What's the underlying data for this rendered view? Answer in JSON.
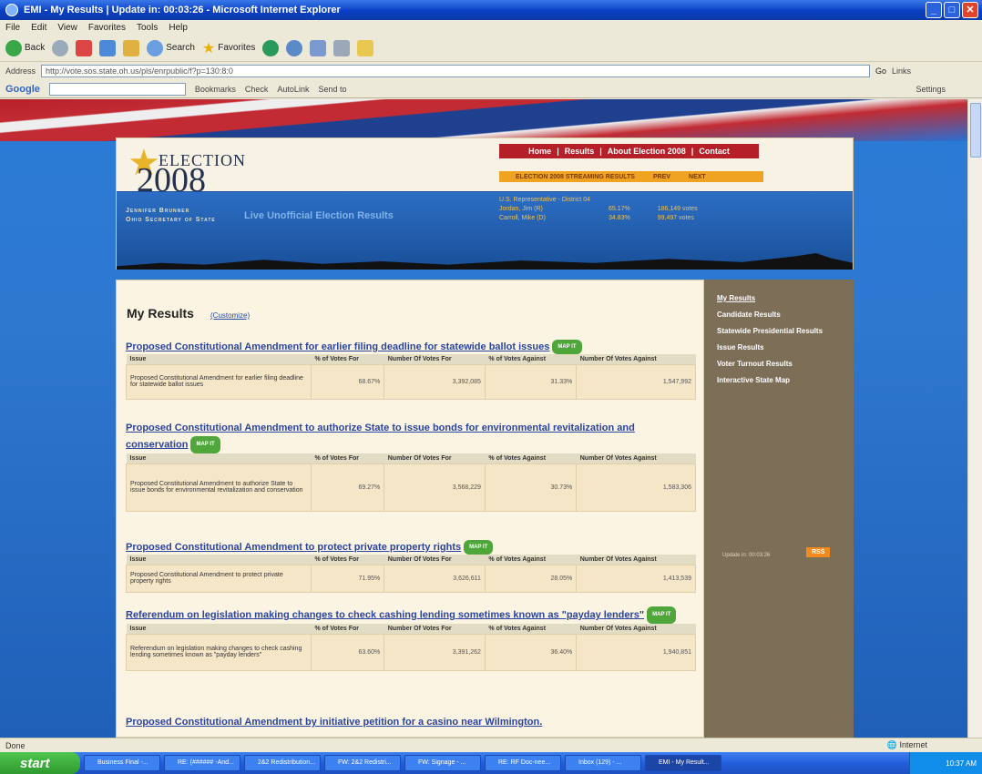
{
  "window": {
    "title": "EMI - My Results | Update in: 00:03:26 - Microsoft Internet Explorer"
  },
  "menu": [
    "File",
    "Edit",
    "View",
    "Favorites",
    "Tools",
    "Help"
  ],
  "toolbar": {
    "back": "Back",
    "search": "Search",
    "favorites": "Favorites"
  },
  "address": {
    "label": "Address",
    "url": "http://vote.sos.state.oh.us/pls/enrpublic/f?p=130:8:0",
    "go": "Go",
    "links": "Links"
  },
  "googlebar": {
    "brand": "Google",
    "bookmarks": "Bookmarks",
    "check": "Check",
    "autolink": "AutoLink",
    "sendto": "Send to",
    "settings": "Settings"
  },
  "site": {
    "logo_election": "ELECTION",
    "logo_year": "2008",
    "nav": [
      "Home",
      "Results",
      "About Election 2008",
      "Contact"
    ],
    "ticker": {
      "label": "ELECTION 2008 STREAMING RESULTS",
      "prev": "PREV",
      "next": "NEXT"
    },
    "sos_name": "Jennifer Brunner",
    "sos_title": "Ohio Secretary of State",
    "tagline": "Live Unofficial Election Results",
    "ticker_race": "U.S. Representative - District 04",
    "ticker_rows": [
      {
        "name": "Jordan, Jim (R)",
        "pct": "65.17%",
        "votes": "186,149 votes"
      },
      {
        "name": "Carroll, Mike (D)",
        "pct": "34.83%",
        "votes": "99,497 votes"
      }
    ]
  },
  "main": {
    "heading": "My Results",
    "customize": "(Customize)",
    "map_label": "MAP IT",
    "headers": [
      "Issue",
      "% of Votes For",
      "Number Of Votes For",
      "% of Votes Against",
      "Number Of Votes Against"
    ],
    "issues": [
      {
        "title": "Proposed Constitutional Amendment for earlier filing deadline for statewide ballot issues",
        "issue": "Proposed Constitutional Amendment for earlier filing deadline for statewide ballot issues",
        "pct_for": "68.67%",
        "num_for": "3,392,085",
        "pct_against": "31.33%",
        "num_against": "1,547,992"
      },
      {
        "title": "Proposed Constitutional Amendment to authorize State to issue bonds for environmental revitalization and conservation",
        "issue": "Proposed Constitutional Amendment to authorize State to issue bonds for environmental revitalization and conservation",
        "pct_for": "69.27%",
        "num_for": "3,568,229",
        "pct_against": "30.73%",
        "num_against": "1,583,306"
      },
      {
        "title": "Proposed Constitutional Amendment to protect private property rights",
        "issue": "Proposed Constitutional Amendment to protect private property rights",
        "pct_for": "71.95%",
        "num_for": "3,626,611",
        "pct_against": "28.05%",
        "num_against": "1,413,539"
      },
      {
        "title": "Referendum on legislation making changes to check cashing lending sometimes known as \"payday lenders\"",
        "issue": "Referendum on legislation making changes to check cashing lending sometimes known as \"payday lenders\"",
        "pct_for": "63.60%",
        "num_for": "3,391,262",
        "pct_against": "36.40%",
        "num_against": "1,940,851"
      },
      {
        "title": "Proposed Constitutional Amendment by initiative petition for a casino near Wilmington."
      }
    ]
  },
  "sidebar": {
    "links": [
      "My Results",
      "Candidate Results",
      "Statewide Presidential Results",
      "Issue Results",
      "Voter Turnout Results",
      "Interactive State Map"
    ],
    "update": "Update in: 00:03:26",
    "rss": "RSS"
  },
  "status": {
    "left": "Done",
    "zone": "Internet"
  },
  "taskbar": {
    "start": "start",
    "tasks": [
      "Business Final -...",
      "RE: (###### -And...",
      "2&2 Redistribution...",
      "FW: 2&2 Redistri...",
      "FW: Signage - ...",
      "RE: RF Doc-nee...",
      "Inbox (129) - ...",
      "EMI - My Result..."
    ],
    "clock": "10:37 AM"
  }
}
